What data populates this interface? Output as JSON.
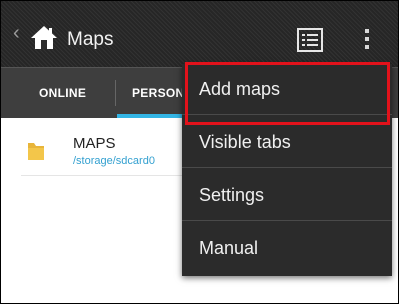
{
  "header": {
    "title": "Maps",
    "back_icon": "chevron-left-icon",
    "home_icon": "home-icon",
    "list_view_icon": "list-view-icon",
    "overflow_icon": "vertical-dots-icon"
  },
  "tabs": [
    {
      "label": "ONLINE",
      "active": false
    },
    {
      "label": "PERSON",
      "active": true
    }
  ],
  "list": {
    "items": [
      {
        "name": "MAPS",
        "path": "/storage/sdcard0",
        "icon": "folder-icon"
      }
    ]
  },
  "overflow_menu": {
    "items": [
      {
        "label": "Add maps",
        "highlighted": true
      },
      {
        "label": "Visible tabs"
      },
      {
        "label": "Settings"
      },
      {
        "label": "Manual"
      }
    ]
  },
  "colors": {
    "accent": "#33b5e5",
    "highlight": "#e2121b",
    "action_bar": "#2b2b2b",
    "menu_background": "#2b2b2b",
    "path_text": "#33a0d0"
  }
}
